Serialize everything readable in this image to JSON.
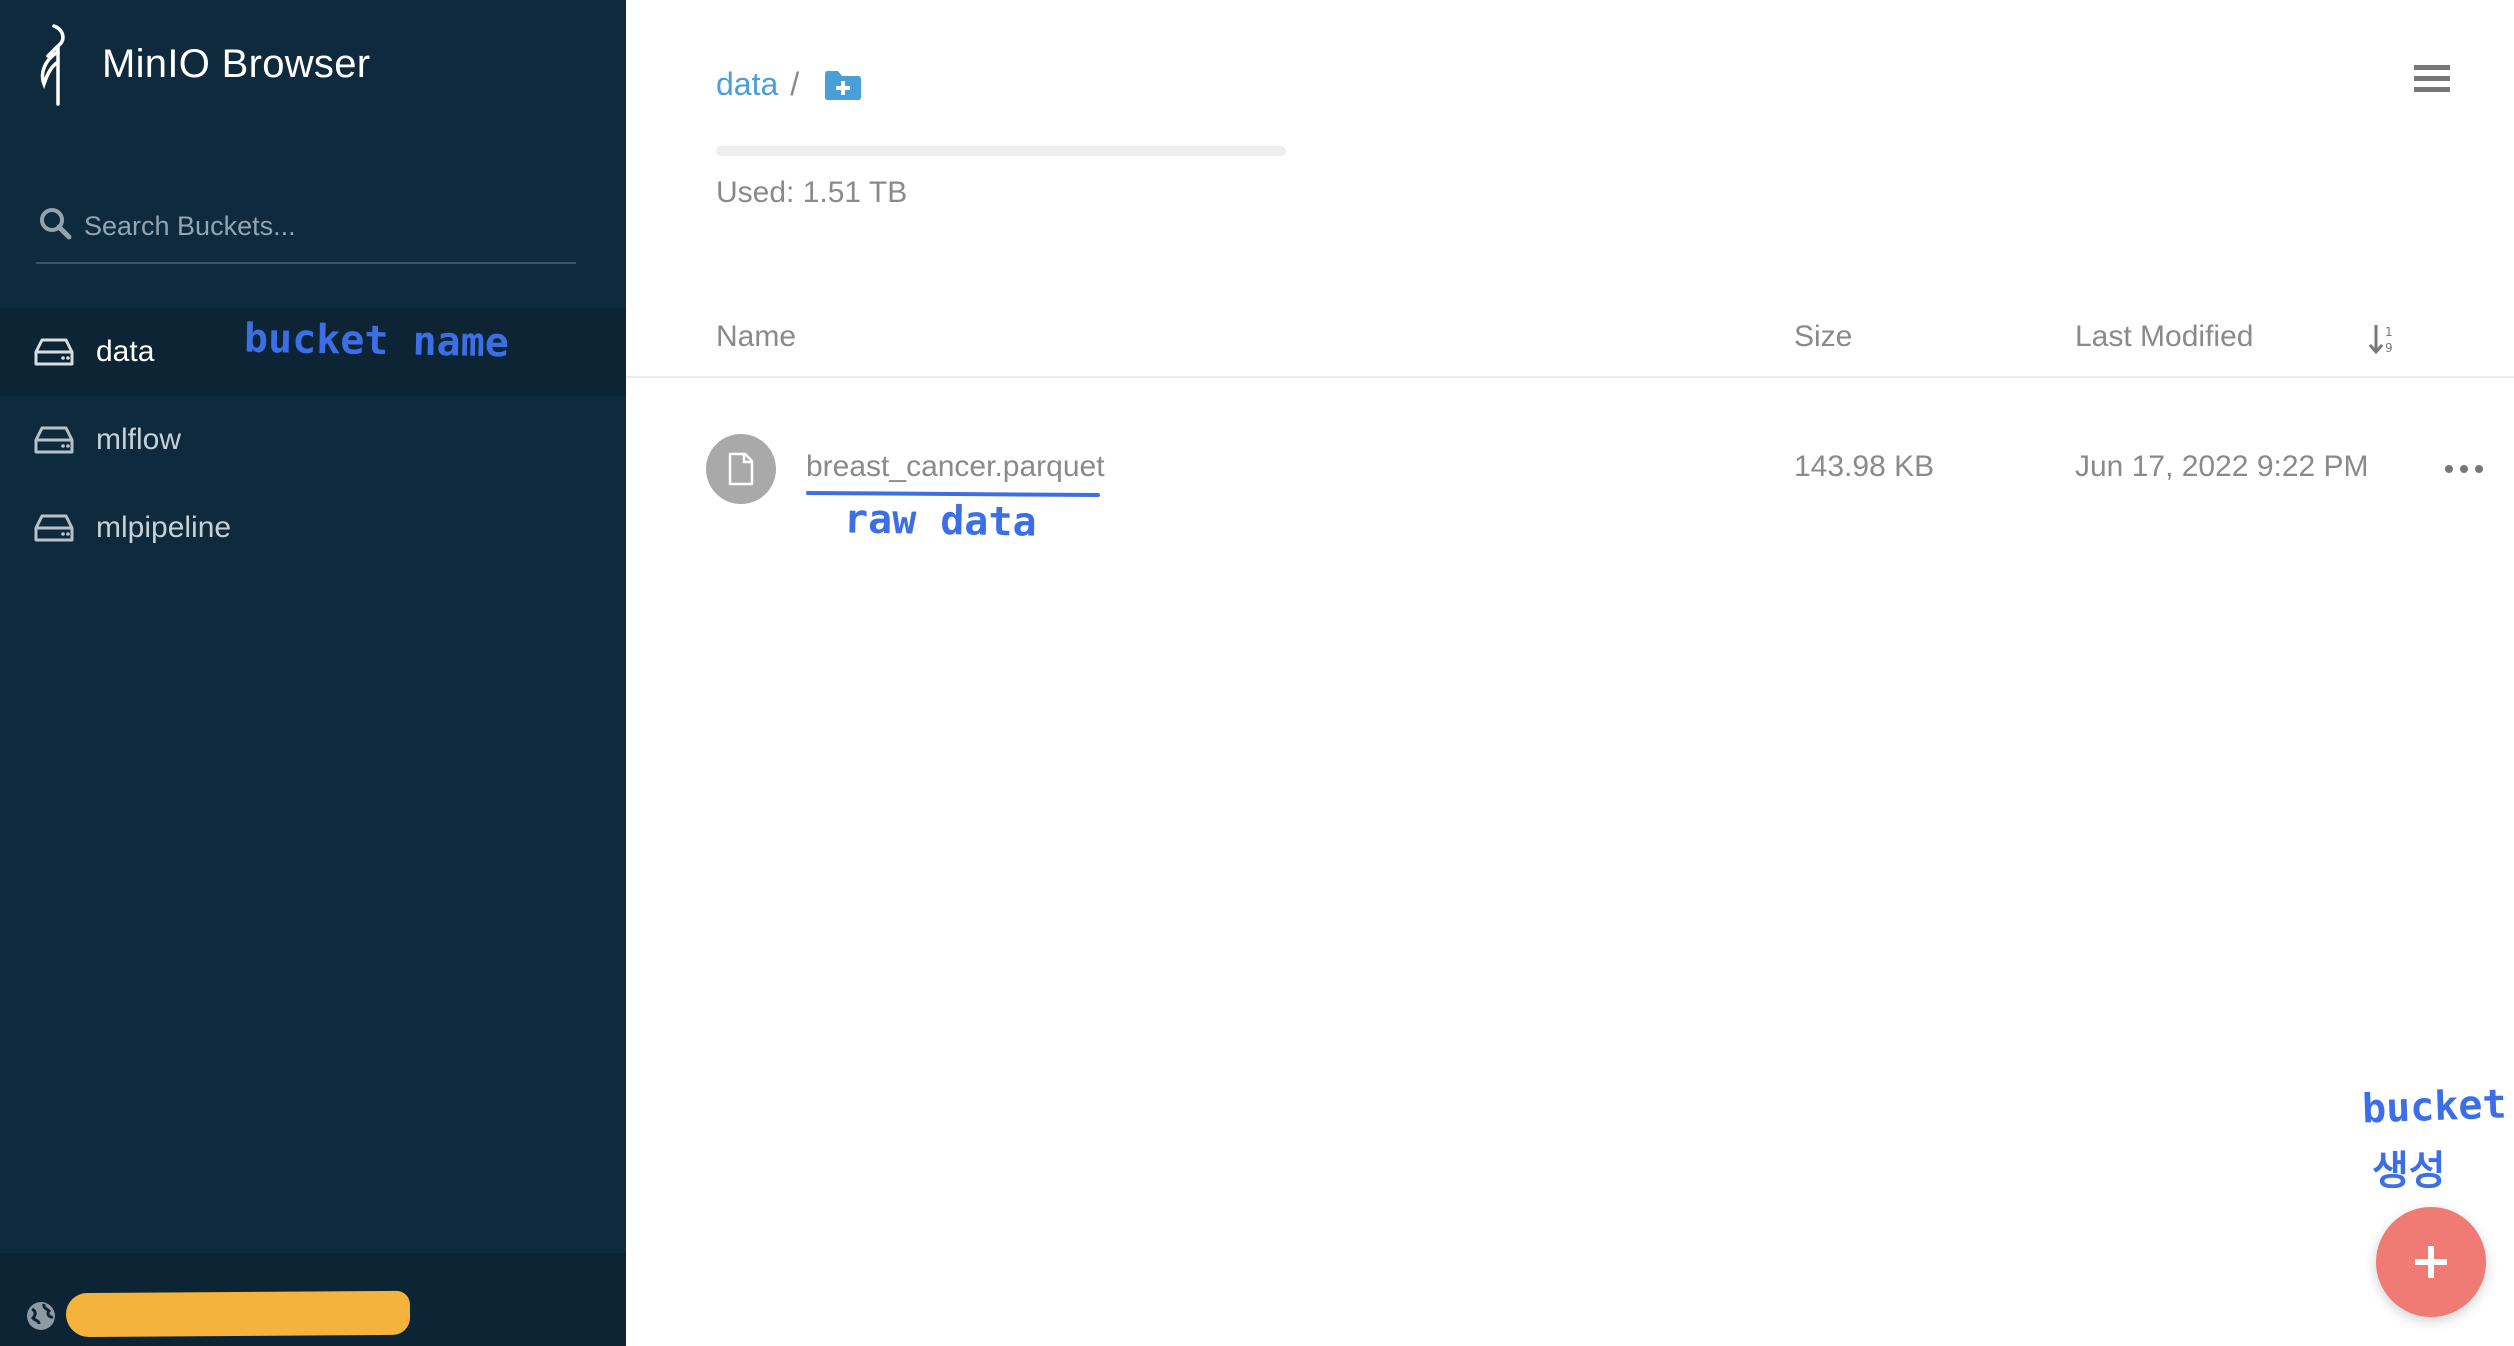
{
  "sidebar": {
    "brand": "MinIO Browser",
    "search_placeholder": "Search Buckets...",
    "buckets": [
      {
        "label": "data",
        "active": true
      },
      {
        "label": "mlflow",
        "active": false
      },
      {
        "label": "mlpipeline",
        "active": false
      }
    ]
  },
  "main": {
    "breadcrumb": {
      "bucket": "data",
      "separator": "/"
    },
    "usage": {
      "text": "Used: 1.51 TB"
    },
    "table": {
      "headers": {
        "name": "Name",
        "size": "Size",
        "modified": "Last Modified"
      },
      "rows": [
        {
          "name": "breast_cancer.parquet",
          "size": "143.98 KB",
          "modified": "Jun 17, 2022 9:22 PM"
        }
      ]
    }
  },
  "annotations": {
    "bucket_name": "bucket name",
    "raw_data": "raw data",
    "bucket": "bucket",
    "create": "생성"
  },
  "colors": {
    "sidebar_bg": "#0f2a3d",
    "link": "#4a9fd8",
    "fab": "#f07a74",
    "annotation": "#3c6fe6",
    "redaction": "#f3b33d"
  },
  "icons": {
    "logo": "minio-logo-icon",
    "search": "search-icon",
    "bucket": "drive-icon",
    "new_folder": "folder-plus-icon",
    "menu": "hamburger-menu-icon",
    "sort": "sort-icon",
    "file": "file-icon",
    "more": "more-horizontal-icon",
    "fab": "plus-icon",
    "footer": "globe-icon"
  }
}
